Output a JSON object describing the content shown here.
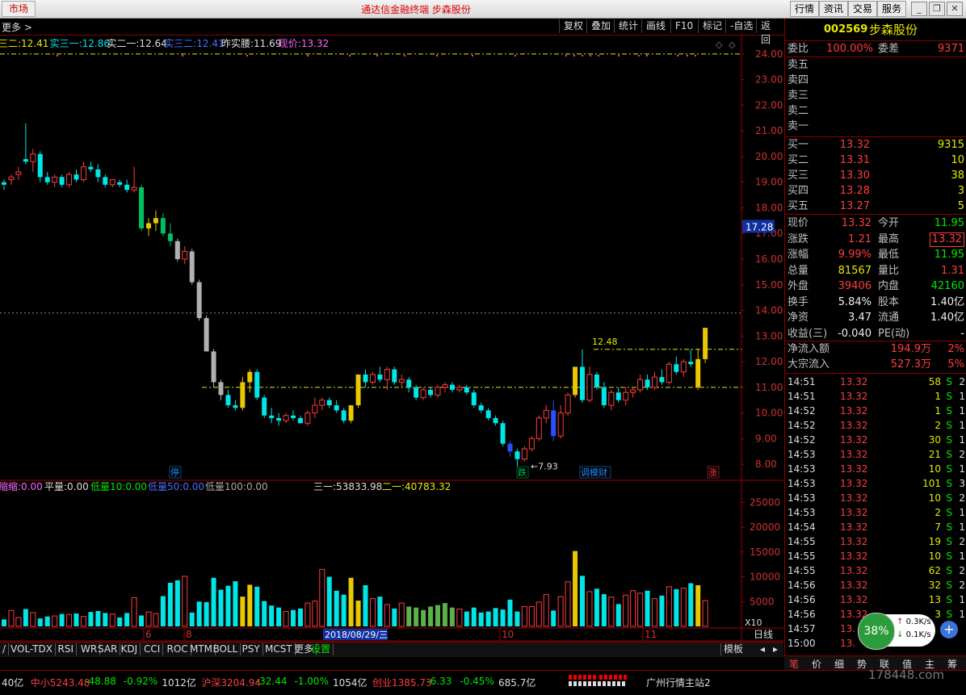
{
  "topbar": {
    "market": "市场",
    "title": "通达信金融终端  步森股份",
    "buttons": [
      "行情",
      "资讯",
      "交易",
      "服务"
    ]
  },
  "toolbar": {
    "left": "更多 >",
    "items": [
      "复权",
      "叠加",
      "统计",
      "画线",
      "F10",
      "标记",
      "-自选",
      "返回"
    ]
  },
  "indicators": {
    "line1": [
      {
        "text": "三二:12.41",
        "color": "#e8e800"
      },
      {
        "text": "实三一:12.86",
        "color": "#00e6e6"
      },
      {
        "text": "实二一:12.64",
        "color": "#dddddd"
      },
      {
        "text": "实三二:12.41",
        "color": "#4a6cff"
      },
      {
        "text": "昨实腰:11.69",
        "color": "#dddddd"
      },
      {
        "text": "现价:13.32",
        "color": "#ff66ff"
      }
    ],
    "volume_line": [
      {
        "text": "缩缩:0.00",
        "color": "#ff66ff"
      },
      {
        "text": "平量:0.00",
        "color": "#dddddd"
      },
      {
        "text": "低量10:0.00",
        "color": "#00e600"
      },
      {
        "text": "低量50:0.00",
        "color": "#4a6cff"
      },
      {
        "text": "低量100:0.00",
        "color": "#aaaaaa"
      },
      {
        "text": "三一:53833.98",
        "color": "#dddddd"
      },
      {
        "text": "二一:40783.32",
        "color": "#e8e800"
      }
    ]
  },
  "price_axis": {
    "ticks": [
      "24.00",
      "23.00",
      "22.00",
      "21.00",
      "20.00",
      "19.00",
      "18.00",
      "17.00",
      "16.00",
      "15.00",
      "14.00",
      "13.00",
      "12.00",
      "11.00",
      "10.00",
      "9.00",
      "8.00"
    ],
    "current": "17.28"
  },
  "volume_axis": {
    "ticks": [
      "25000",
      "20000",
      "15000",
      "10000",
      "5000"
    ],
    "unit": "X10"
  },
  "annotations": {
    "high": "12.48",
    "low": "7.93",
    "badges": [
      "停",
      "跌",
      "调模财",
      "涨"
    ]
  },
  "xaxis": {
    "labels": [
      "6",
      "8",
      "10",
      "11"
    ],
    "cursor_date": "2018/08/29/三",
    "right": "日线"
  },
  "chart_data": {
    "type": "candlestick",
    "ylim": [
      7.5,
      24.5
    ],
    "candles": [
      [
        19.0,
        19.1,
        18.7,
        18.9
      ],
      [
        19.1,
        19.3,
        18.9,
        19.2
      ],
      [
        19.3,
        19.6,
        19.1,
        19.4
      ],
      [
        19.9,
        21.3,
        19.7,
        19.8
      ],
      [
        19.8,
        20.3,
        19.4,
        20.1
      ],
      [
        20.1,
        20.2,
        19.0,
        19.2
      ],
      [
        19.2,
        19.4,
        18.9,
        19.0
      ],
      [
        19.0,
        19.3,
        18.8,
        19.2
      ],
      [
        19.2,
        19.3,
        18.8,
        18.9
      ],
      [
        18.9,
        19.4,
        18.8,
        19.3
      ],
      [
        19.3,
        19.5,
        19.0,
        19.1
      ],
      [
        19.1,
        19.8,
        19.0,
        19.6
      ],
      [
        19.6,
        19.8,
        19.4,
        19.5
      ],
      [
        19.5,
        19.7,
        19.0,
        19.2
      ],
      [
        19.2,
        19.3,
        18.8,
        18.9
      ],
      [
        18.9,
        19.1,
        18.8,
        19.1
      ],
      [
        19.0,
        19.1,
        18.8,
        18.9
      ],
      [
        18.9,
        19.1,
        18.6,
        18.7
      ],
      [
        18.7,
        19.6,
        18.6,
        18.8
      ],
      [
        18.8,
        18.9,
        17.1,
        17.2
      ],
      [
        17.2,
        17.6,
        16.9,
        17.4
      ],
      [
        17.4,
        17.9,
        17.1,
        17.6
      ],
      [
        17.6,
        17.8,
        16.9,
        17.0
      ],
      [
        17.0,
        17.4,
        16.5,
        16.7
      ],
      [
        16.7,
        16.8,
        15.9,
        16.0
      ],
      [
        16.0,
        16.5,
        15.8,
        16.3
      ],
      [
        16.3,
        16.4,
        15.0,
        15.1
      ],
      [
        15.1,
        15.2,
        13.6,
        13.7
      ],
      [
        13.7,
        13.8,
        12.4,
        12.4
      ],
      [
        12.4,
        12.5,
        11.0,
        11.2
      ],
      [
        11.2,
        11.3,
        10.5,
        10.7
      ],
      [
        10.7,
        10.9,
        10.2,
        10.3
      ],
      [
        10.3,
        10.5,
        10.1,
        10.2
      ],
      [
        10.2,
        11.4,
        10.1,
        11.2
      ],
      [
        11.2,
        11.7,
        10.8,
        11.6
      ],
      [
        11.6,
        11.7,
        10.5,
        10.6
      ],
      [
        10.6,
        10.7,
        9.8,
        9.9
      ],
      [
        9.9,
        10.2,
        9.6,
        9.8
      ],
      [
        9.8,
        10.0,
        9.5,
        9.7
      ],
      [
        9.7,
        10.0,
        9.6,
        9.9
      ],
      [
        9.9,
        10.1,
        9.7,
        9.8
      ],
      [
        9.8,
        9.9,
        9.6,
        9.6
      ],
      [
        9.6,
        10.1,
        9.5,
        10.0
      ],
      [
        10.0,
        10.6,
        9.8,
        10.3
      ],
      [
        10.3,
        10.6,
        10.1,
        10.5
      ],
      [
        10.5,
        10.6,
        10.2,
        10.3
      ],
      [
        10.3,
        10.5,
        10.0,
        10.1
      ],
      [
        10.1,
        10.2,
        9.6,
        9.7
      ],
      [
        9.7,
        10.3,
        9.6,
        10.3
      ],
      [
        10.3,
        11.5,
        10.2,
        11.5
      ],
      [
        11.5,
        11.7,
        11.0,
        11.2
      ],
      [
        11.2,
        11.6,
        11.1,
        11.5
      ],
      [
        11.5,
        11.8,
        11.2,
        11.3
      ],
      [
        11.3,
        11.8,
        10.9,
        11.7
      ],
      [
        11.7,
        11.8,
        11.1,
        11.2
      ],
      [
        11.2,
        11.5,
        11.0,
        11.3
      ],
      [
        11.3,
        11.4,
        10.8,
        11.0
      ],
      [
        11.0,
        11.1,
        10.5,
        10.6
      ],
      [
        10.6,
        11.0,
        10.5,
        10.9
      ],
      [
        10.9,
        11.0,
        10.6,
        10.7
      ],
      [
        10.7,
        11.1,
        10.6,
        11.0
      ],
      [
        11.0,
        11.2,
        10.8,
        11.1
      ],
      [
        11.1,
        11.2,
        10.8,
        10.9
      ],
      [
        10.9,
        11.1,
        10.8,
        11.0
      ],
      [
        11.0,
        11.1,
        10.7,
        10.8
      ],
      [
        10.8,
        10.9,
        10.2,
        10.3
      ],
      [
        10.3,
        10.4,
        10.0,
        10.1
      ],
      [
        10.1,
        10.2,
        9.7,
        9.8
      ],
      [
        9.8,
        9.9,
        9.5,
        9.6
      ],
      [
        9.6,
        9.7,
        8.7,
        8.8
      ],
      [
        8.8,
        8.9,
        8.3,
        8.5
      ],
      [
        8.5,
        8.6,
        7.93,
        8.2
      ],
      [
        8.2,
        8.7,
        8.1,
        8.6
      ],
      [
        8.6,
        9.1,
        8.5,
        9.0
      ],
      [
        9.0,
        9.9,
        8.9,
        9.8
      ],
      [
        9.8,
        10.3,
        9.6,
        10.1
      ],
      [
        10.1,
        10.5,
        8.9,
        9.1
      ],
      [
        9.1,
        10.3,
        9.0,
        10.0
      ],
      [
        10.0,
        10.8,
        9.9,
        10.7
      ],
      [
        10.7,
        11.8,
        10.6,
        11.8
      ],
      [
        11.8,
        12.48,
        10.4,
        10.5
      ],
      [
        10.5,
        11.8,
        10.4,
        11.5
      ],
      [
        11.5,
        11.6,
        10.9,
        11.0
      ],
      [
        11.0,
        11.2,
        10.2,
        10.3
      ],
      [
        10.3,
        10.9,
        10.1,
        10.8
      ],
      [
        10.8,
        11.0,
        10.4,
        10.5
      ],
      [
        10.5,
        11.0,
        10.3,
        10.8
      ],
      [
        10.8,
        11.0,
        10.6,
        10.9
      ],
      [
        10.9,
        11.5,
        10.8,
        11.3
      ],
      [
        11.3,
        11.5,
        10.9,
        11.0
      ],
      [
        11.0,
        11.6,
        10.9,
        11.4
      ],
      [
        11.4,
        11.7,
        11.1,
        11.2
      ],
      [
        11.2,
        12.0,
        11.1,
        11.9
      ],
      [
        11.9,
        12.2,
        11.5,
        11.6
      ],
      [
        11.6,
        12.1,
        11.4,
        12.0
      ],
      [
        12.0,
        12.48,
        11.8,
        11.9
      ],
      [
        11.0,
        12.48,
        10.9,
        12.1
      ],
      [
        12.1,
        13.32,
        11.95,
        13.32
      ]
    ],
    "volumes": [
      1400,
      3200,
      1800,
      3500,
      2800,
      1600,
      2000,
      2100,
      2500,
      2400,
      2600,
      2000,
      2900,
      3100,
      2700,
      2500,
      1800,
      2700,
      5800,
      2200,
      2900,
      2600,
      6100,
      8800,
      9300,
      10100,
      2800,
      5000,
      4900,
      9800,
      7400,
      8200,
      9100,
      6000,
      8400,
      8000,
      5100,
      4200,
      3800,
      3000,
      3300,
      3600,
      4700,
      5100,
      11500,
      10000,
      7200,
      6400,
      9800,
      5200,
      8300,
      5600,
      6000,
      4400,
      3600,
      4700,
      4000,
      3800,
      3300,
      4000,
      4300,
      4700,
      3800,
      3500,
      3000,
      3800,
      2800,
      3000,
      3700,
      3400,
      5400,
      3000,
      4000,
      4000,
      4900,
      6400,
      3200,
      6000,
      9000,
      15200,
      10200,
      7000,
      7600,
      6500,
      5900,
      4500,
      6300,
      7200,
      6700,
      7200,
      5600,
      6200,
      8000,
      7500,
      7700,
      8700,
      8300,
      5200
    ]
  },
  "quote": {
    "code": "002569",
    "name": "步森股份",
    "weibi_label": "委比",
    "weibi": "100.00%",
    "weicha_label": "委差",
    "weicha": "9371",
    "sell": [
      {
        "label": "卖五",
        "price": "",
        "vol": ""
      },
      {
        "label": "卖四",
        "price": "",
        "vol": ""
      },
      {
        "label": "卖三",
        "price": "",
        "vol": ""
      },
      {
        "label": "卖二",
        "price": "",
        "vol": ""
      },
      {
        "label": "卖一",
        "price": "",
        "vol": ""
      }
    ],
    "buy": [
      {
        "label": "买一",
        "price": "13.32",
        "vol": "9315"
      },
      {
        "label": "买二",
        "price": "13.31",
        "vol": "10"
      },
      {
        "label": "买三",
        "price": "13.30",
        "vol": "38"
      },
      {
        "label": "买四",
        "price": "13.28",
        "vol": "3"
      },
      {
        "label": "买五",
        "price": "13.27",
        "vol": "5"
      }
    ],
    "stats": [
      {
        "l1": "现价",
        "v1": "13.32",
        "c1": "red",
        "l2": "今开",
        "v2": "11.95",
        "c2": "grn"
      },
      {
        "l1": "涨跌",
        "v1": "1.21",
        "c1": "red",
        "l2": "最高",
        "v2": "13.32",
        "c2": "red"
      },
      {
        "l1": "涨幅",
        "v1": "9.99%",
        "c1": "red",
        "l2": "最低",
        "v2": "11.95",
        "c2": "grn"
      },
      {
        "l1": "总量",
        "v1": "81567",
        "c1": "yel",
        "l2": "量比",
        "v2": "1.31",
        "c2": "red"
      },
      {
        "l1": "外盘",
        "v1": "39406",
        "c1": "red",
        "l2": "内盘",
        "v2": "42160",
        "c2": "grn"
      },
      {
        "l1": "换手",
        "v1": "5.84%",
        "c1": "wht",
        "l2": "股本",
        "v2": "1.40亿",
        "c2": "wht"
      },
      {
        "l1": "净资",
        "v1": "3.47",
        "c1": "wht",
        "l2": "流通",
        "v2": "1.40亿",
        "c2": "wht"
      },
      {
        "l1": "收益(三)",
        "v1": "-0.040",
        "c1": "wht",
        "l2": "PE(动)",
        "v2": "-",
        "c2": "wht"
      }
    ],
    "flow": [
      {
        "label": "净流入额",
        "value": "194.9万",
        "pct": "2%"
      },
      {
        "label": "大宗流入",
        "value": "527.3万",
        "pct": "5%"
      }
    ],
    "ticks": [
      [
        "14:51",
        "13.32",
        "58",
        "S",
        "2"
      ],
      [
        "14:51",
        "13.32",
        "1",
        "S",
        "1"
      ],
      [
        "14:52",
        "13.32",
        "1",
        "S",
        "1"
      ],
      [
        "14:52",
        "13.32",
        "2",
        "S",
        "1"
      ],
      [
        "14:52",
        "13.32",
        "30",
        "S",
        "1"
      ],
      [
        "14:53",
        "13.32",
        "21",
        "S",
        "2"
      ],
      [
        "14:53",
        "13.32",
        "10",
        "S",
        "1"
      ],
      [
        "14:53",
        "13.32",
        "101",
        "S",
        "3"
      ],
      [
        "14:53",
        "13.32",
        "10",
        "S",
        "2"
      ],
      [
        "14:53",
        "13.32",
        "2",
        "S",
        "1"
      ],
      [
        "14:54",
        "13.32",
        "7",
        "S",
        "1"
      ],
      [
        "14:55",
        "13.32",
        "19",
        "S",
        "2"
      ],
      [
        "14:55",
        "13.32",
        "10",
        "S",
        "1"
      ],
      [
        "14:55",
        "13.32",
        "62",
        "S",
        "2"
      ],
      [
        "14:56",
        "13.32",
        "32",
        "S",
        "2"
      ],
      [
        "14:56",
        "13.32",
        "13",
        "S",
        "1"
      ],
      [
        "14:56",
        "13.32",
        "3",
        "S",
        "1"
      ],
      [
        "14:57",
        "13.",
        "",
        "",
        ""
      ],
      [
        "15:00",
        "13.",
        "",
        "",
        ""
      ]
    ],
    "speed": {
      "pct": "38%",
      "up": "0.3K/s",
      "down": "0.1K/s"
    }
  },
  "bottom_tabs": [
    "VOL-TDX",
    "RSI",
    "WR",
    "SAR",
    "KDJ",
    "CCI",
    "ROC",
    "MTM",
    "BOLL",
    "PSY",
    "MCST",
    "更多",
    "设置"
  ],
  "bottom_tab_right": "模板",
  "right_tabs": [
    "笔",
    "价",
    "细",
    "势",
    "联",
    "值",
    "主",
    "筹"
  ],
  "statusbar": {
    "items": [
      {
        "text": "40亿",
        "color": "#dddddd"
      },
      {
        "text": "中小5243.48",
        "color": "#ff3c3c"
      },
      {
        "text": "-48.88",
        "color": "#00e600"
      },
      {
        "text": "-0.92%",
        "color": "#00e600"
      },
      {
        "text": "1012亿",
        "color": "#dddddd"
      },
      {
        "text": "沪深3204.94",
        "color": "#ff3c3c"
      },
      {
        "text": "-32.44",
        "color": "#00e600"
      },
      {
        "text": "-1.00%",
        "color": "#00e600"
      },
      {
        "text": "1054亿",
        "color": "#dddddd"
      },
      {
        "text": "创业1385.73",
        "color": "#ff3c3c"
      },
      {
        "text": "-6.33",
        "color": "#00e600"
      },
      {
        "text": "-0.45%",
        "color": "#00e600"
      },
      {
        "text": "685.7亿",
        "color": "#dddddd"
      }
    ],
    "server": "广州行情主站2",
    "watermark": "178448.com"
  }
}
